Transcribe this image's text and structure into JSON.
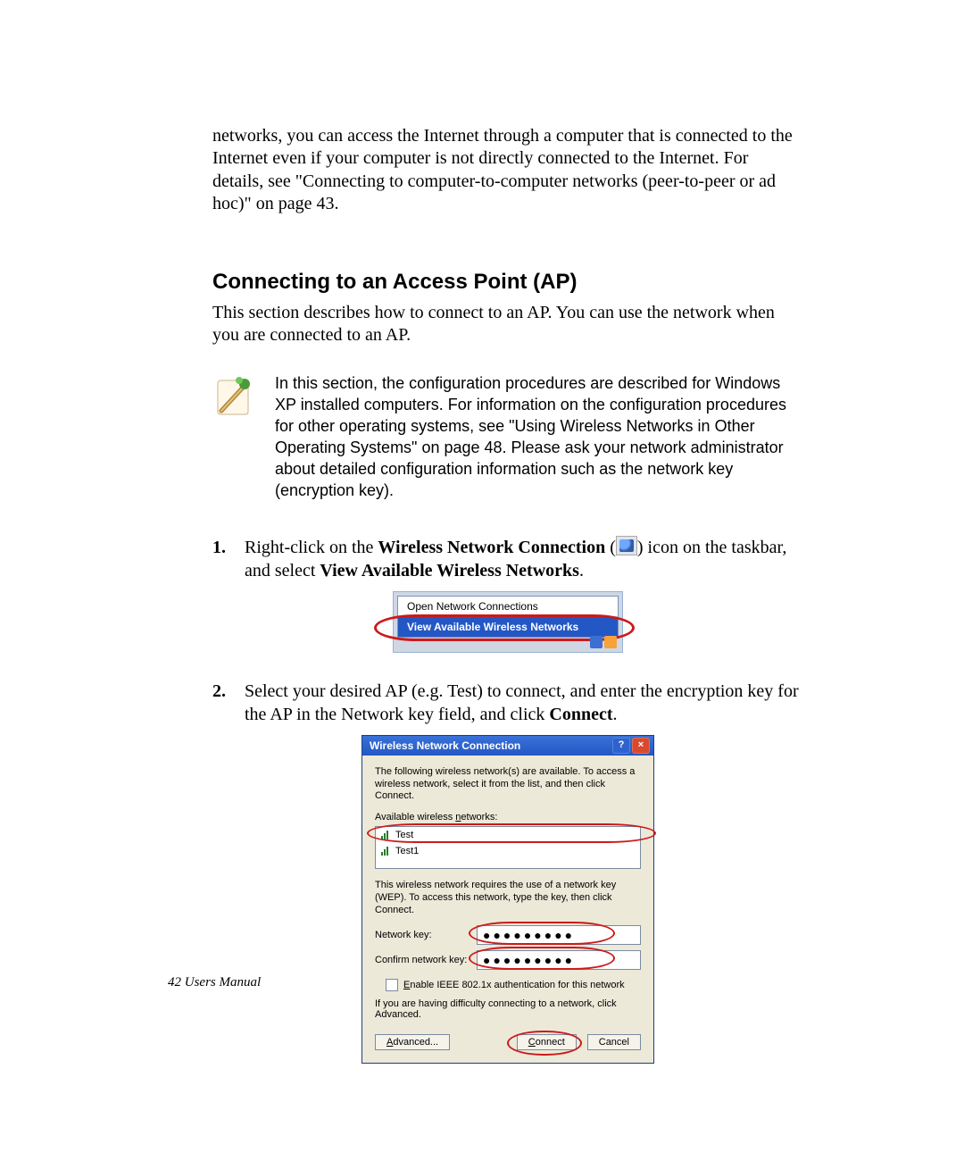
{
  "intro_paragraph": "networks, you can access the Internet through a computer that is connected to the Internet even if your computer is not directly connected to the Internet. For details, see \"Connecting to computer-to-computer networks (peer-to-peer or ad hoc)\" on page 43.",
  "heading": "Connecting to an Access Point (AP)",
  "section_intro": "This section describes how to connect to an AP. You can use the network when you are connected to an AP.",
  "note_text": "In this section, the configuration procedures are described for Windows XP installed computers. For information on the configuration procedures for other operating systems, see \"Using Wireless Networks in Other Operating Systems\" on page 48. Please ask your network administrator about detailed configuration information such as the network key (encryption key).",
  "steps": {
    "s1": {
      "num": "1.",
      "pre": "Right-click on the ",
      "bold1": "Wireless Network Connection",
      "mid": " (",
      "post": ") icon on the taskbar, and select ",
      "bold2": "View Available Wireless Networks",
      "end": "."
    },
    "s2": {
      "num": "2.",
      "pre": "Select your desired AP (e.g. Test) to connect, and enter the encryption key for the AP in the Network key field, and click ",
      "bold": "Connect",
      "end": "."
    }
  },
  "ctx_menu": {
    "item1": "Open Network Connections",
    "item2": "View Available Wireless Networks"
  },
  "dialog": {
    "title": "Wireless Network Connection",
    "help": "?",
    "close": "×",
    "desc": "The following wireless network(s) are available. To access a wireless network, select it from the list, and then click Connect.",
    "avail_label_pre": "Available wireless ",
    "avail_label_ul": "n",
    "avail_label_post": "etworks:",
    "networks": {
      "n0": "Test",
      "n1": "Test1"
    },
    "wep_text": "This wireless network requires the use of a network key (WEP). To access this network, type the key, then click Connect.",
    "netkey_label": "Network key:",
    "confirmkey_label": "Confirm network key:",
    "key_mask": "●●●●●●●●●",
    "chk_label_pre": "E",
    "chk_label_post": "nable IEEE 802.1x authentication for this network",
    "adv_text": "If you are having difficulty connecting to a network, click Advanced.",
    "btn_advanced": "Advanced...",
    "btn_connect": "Connect",
    "btn_cancel": "Cancel"
  },
  "footer": "42  Users Manual"
}
